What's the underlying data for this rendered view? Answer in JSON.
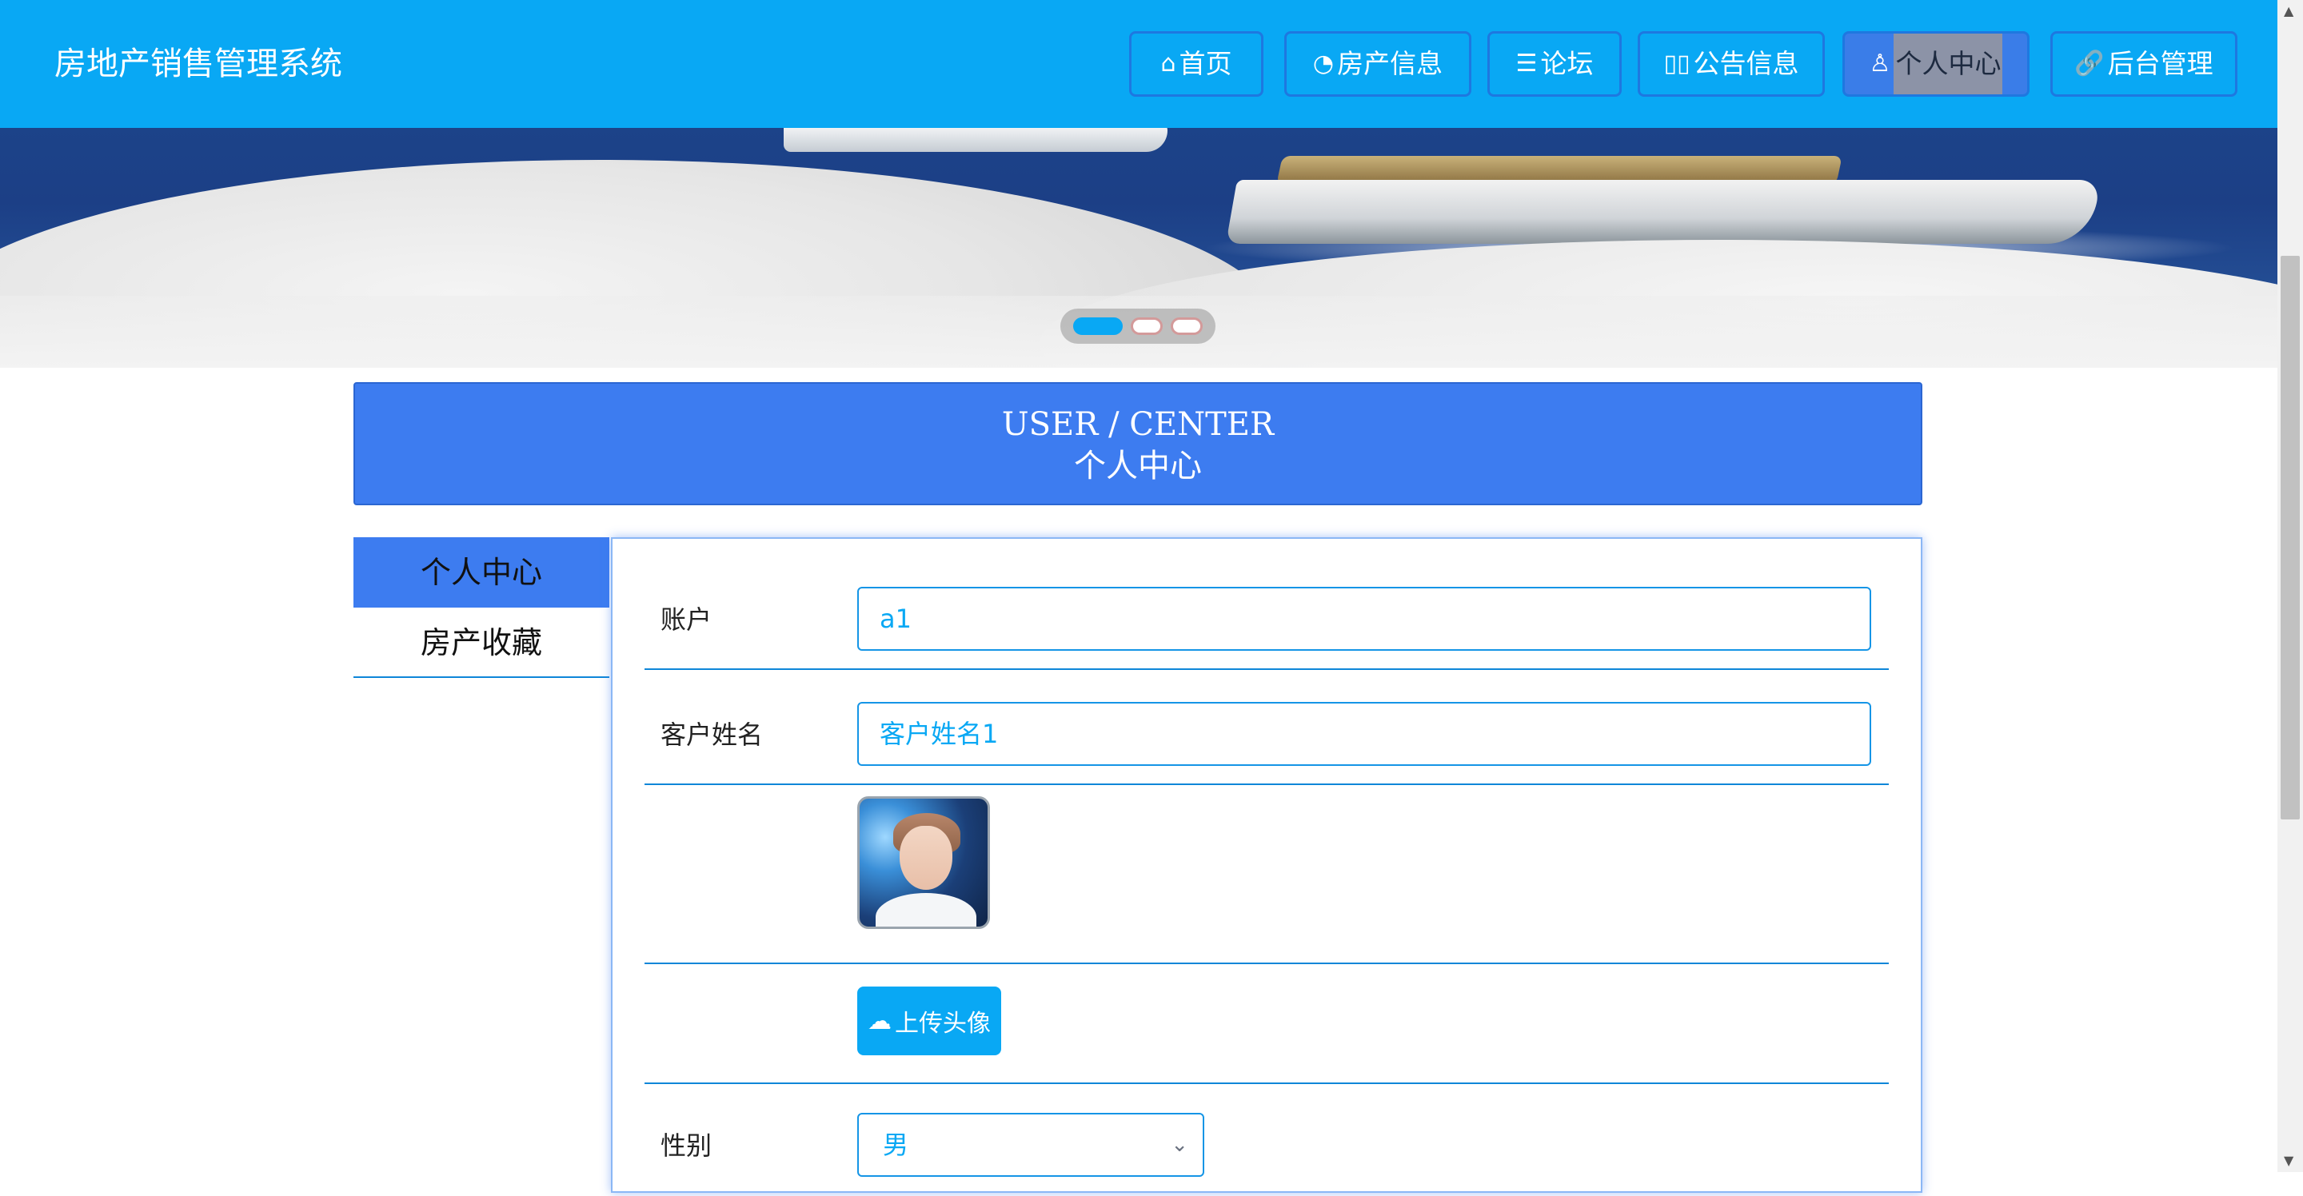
{
  "header": {
    "brand": "房地产销售管理系统",
    "nav": [
      {
        "label": "首页",
        "icon": "home-icon",
        "glyph": "⌂"
      },
      {
        "label": "房产信息",
        "icon": "dashboard-icon",
        "glyph": "◔"
      },
      {
        "label": "论坛",
        "icon": "sliders-icon",
        "glyph": "☰"
      },
      {
        "label": "公告信息",
        "icon": "notice-icon",
        "glyph": "▯▯"
      },
      {
        "label": "个人中心",
        "icon": "user-icon",
        "glyph": "♙"
      },
      {
        "label": "后台管理",
        "icon": "link-icon",
        "glyph": "🔗"
      }
    ],
    "active": "个人中心"
  },
  "carousel": {
    "slides": 3,
    "active_index": 0
  },
  "title_bar": {
    "en": "USER / CENTER",
    "zh": "个人中心"
  },
  "side_menu": {
    "items": [
      "个人中心",
      "房产收藏"
    ],
    "active": "个人中心"
  },
  "form": {
    "account": {
      "label": "账户",
      "value": "a1"
    },
    "name": {
      "label": "客户姓名",
      "value": "客户姓名1"
    },
    "avatar": {
      "icon": "avatar-photo"
    },
    "upload": {
      "label": "上传头像",
      "icon": "cloud-upload-icon",
      "glyph": "☁"
    },
    "gender": {
      "label": "性别",
      "value": "男",
      "icon": "chevron-down-icon"
    }
  },
  "colors": {
    "header": "#09a8f4",
    "accent": "#3d7cf0",
    "border": "#0e86d8"
  }
}
